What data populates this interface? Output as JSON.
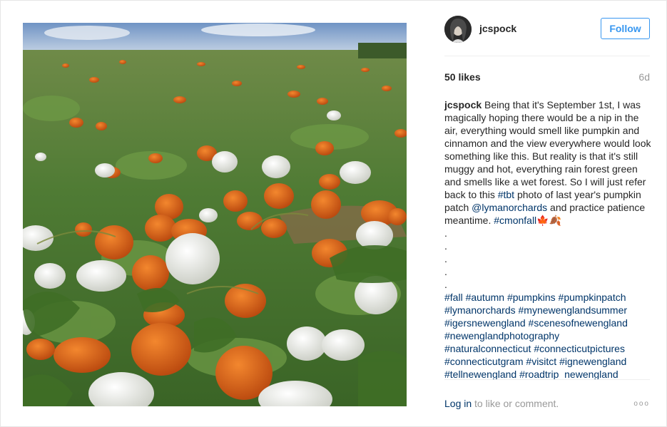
{
  "post": {
    "username": "jcspock",
    "follow_label": "Follow",
    "likes": "50 likes",
    "age": "6d",
    "caption_user": "jcspock",
    "caption_part1": " Being that it's September 1st, I was magically hoping there would be a nip in the air, everything would smell like pumpkin and cinnamon and the view everywhere would look something like this. But reality is that it's still muggy and hot, everything rain forest green and smells like a wet forest. So I will just refer back to this ",
    "tag_tbt": "#tbt",
    "caption_part2": " photo of last year's pumpkin patch ",
    "mention": "@lymanorchards",
    "caption_part3": " and practice patience meantime. ",
    "tag_cmonfall": "#cmonfall",
    "emoji": "🍁🍂",
    "dots": [
      ".",
      ".",
      ".",
      ".",
      "."
    ],
    "hashtags": [
      "#fall",
      "#autumn",
      "#pumpkins",
      "#pumpkinpatch",
      "#lymanorchards",
      "#mynewenglandsummer",
      "#igersnewengland",
      "#scenesofnewengland",
      "#newenglandphotography",
      "#naturalconnecticut",
      "#connecticutpictures",
      "#connecticutgram",
      "#visitct",
      "#ignewengland",
      "#tellnewengland",
      "#roadtrip_newengland"
    ],
    "login_label": "Log in",
    "login_suffix": " to like or comment.",
    "more_label": "ooo"
  },
  "colors": {
    "link": "#003569",
    "follow_blue": "#3897f0",
    "muted": "#999999"
  },
  "icons": {
    "more": "more-options-icon"
  }
}
